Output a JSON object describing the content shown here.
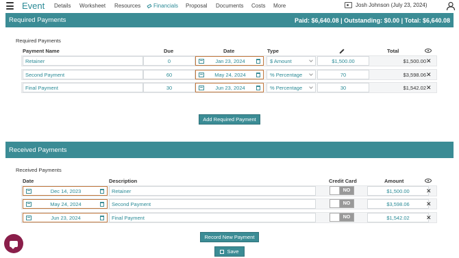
{
  "nav": {
    "brand": "Event",
    "items": [
      {
        "label": "Details"
      },
      {
        "label": "Worksheet"
      },
      {
        "label": "Resources"
      },
      {
        "label": "Financials"
      },
      {
        "label": "Proposal"
      },
      {
        "label": "Documents"
      },
      {
        "label": "Costs"
      },
      {
        "label": "More"
      }
    ],
    "user": "Josh Johnson (July 23, 2024)"
  },
  "required": {
    "header_title": "Required Payments",
    "totals": "Paid: $6,640.08 | Outstanding: $0.00 | Total: $6,640.08",
    "sub_label": "Required Payments",
    "columns": {
      "name": "Payment Name",
      "due": "Due",
      "date": "Date",
      "type": "Type",
      "total": "Total"
    },
    "rows": [
      {
        "name": "Retainer",
        "due": "0",
        "date": "Jan 23, 2024",
        "type": "$ Amount",
        "value": "$1,500.00",
        "total": "$1,500.00"
      },
      {
        "name": "Second Payment",
        "due": "60",
        "date": "May 24, 2024",
        "type": "% Percentage",
        "value": "70",
        "total": "$3,598.06"
      },
      {
        "name": "Final Payment",
        "due": "30",
        "date": "Jun 23, 2024",
        "type": "% Percentage",
        "value": "30",
        "total": "$1,542.02"
      }
    ],
    "add_button": "Add Required Payment"
  },
  "received": {
    "header_title": "Received Payments",
    "sub_label": "Received Payments",
    "columns": {
      "date": "Date",
      "description": "Description",
      "credit_card": "Credit Card",
      "amount": "Amount"
    },
    "rows": [
      {
        "date": "Dec 14, 2023",
        "description": "Retainer",
        "credit_card": "NO",
        "amount": "$1,500.00"
      },
      {
        "date": "May 24, 2024",
        "description": "Second Payment",
        "credit_card": "NO",
        "amount": "$3,598.06"
      },
      {
        "date": "Jun 23, 2024",
        "description": "Final Payment",
        "credit_card": "NO",
        "amount": "$1,542.02"
      }
    ],
    "record_button": "Record New Payment"
  },
  "save_button": "Save",
  "close_symbol": "✕",
  "colors": {
    "accent": "#3b8c95",
    "date_border": "#c2783d",
    "chat": "#8a1e4a"
  }
}
